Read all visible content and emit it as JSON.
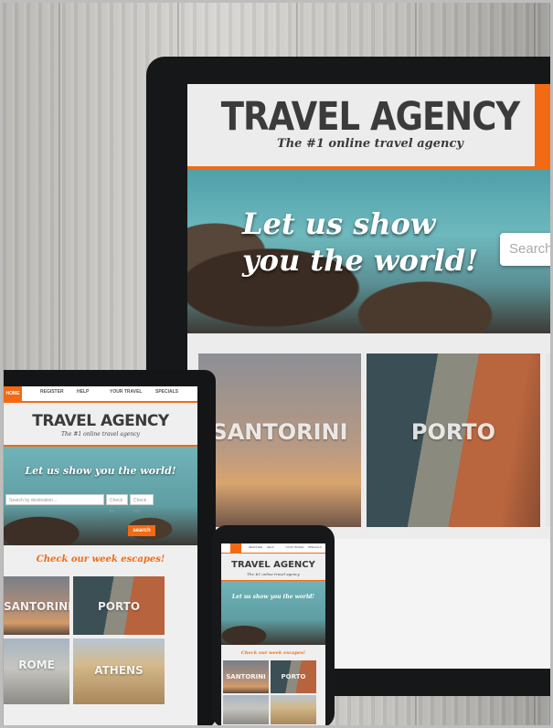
{
  "site": {
    "title": "TRAVEL AGENCY",
    "tagline": "The #1 online travel agency",
    "hero_text": "Let us show you the world!",
    "hero_line1": "Let us show",
    "hero_line2": "you the world!",
    "search_placeholder": "Search",
    "accent_color": "#f36a14"
  },
  "nav": {
    "home": "HOME",
    "register": "REGISTER",
    "help": "HELP",
    "your_travel": "YOUR TRAVEL",
    "specials": "SPECIALS"
  },
  "search": {
    "destination_placeholder": "Search by destination...",
    "check_in": "Check in",
    "check_out": "Check out",
    "button": "search"
  },
  "section": {
    "week_escapes": "Check our week escapes!"
  },
  "destinations": [
    "SANTORINI",
    "PORTO",
    "ROME",
    "ATHENS"
  ],
  "icons": {
    "search_icon": "search-icon"
  }
}
